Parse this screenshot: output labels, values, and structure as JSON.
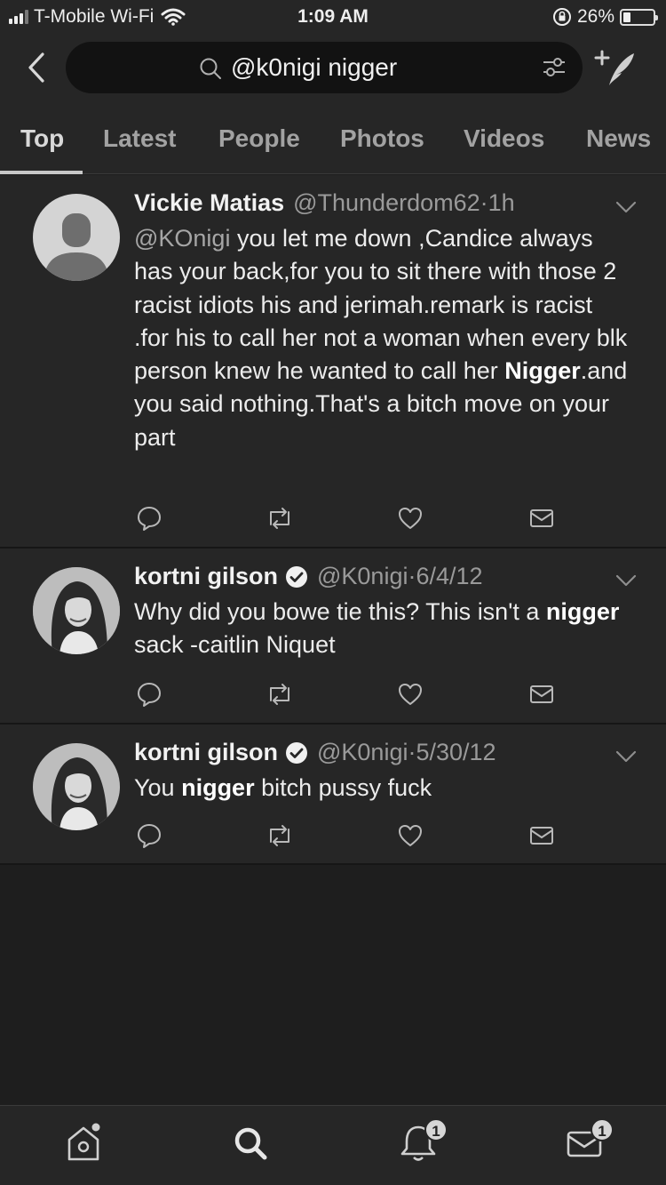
{
  "status_bar": {
    "carrier": "T-Mobile Wi-Fi",
    "time": "1:09 AM",
    "battery_percent": "26%",
    "battery_level": 0.26
  },
  "search": {
    "query": "@k0nigi nigger",
    "icons": [
      "back-chevron-icon",
      "search-icon",
      "filter-icon",
      "compose-tweet-icon"
    ]
  },
  "tabs": [
    "Top",
    "Latest",
    "People",
    "Photos",
    "Videos",
    "News"
  ],
  "active_tab": "Top",
  "tweets": [
    {
      "name": "Vickie Matias",
      "handle": "@Thunderdom62",
      "time": "1h",
      "verified": false,
      "body": {
        "mention": "@KOnigi",
        "text1": " you let me down ,Candice always has your back,for you to sit there with those 2 racist idiots his and jerimah.remark is racist .for his to call her not a woman when every blk person knew he wanted to call her ",
        "highlight": "Nigger",
        "text2": ".and you said nothing.That's a bitch move on your part"
      }
    },
    {
      "name": "kortni gilson",
      "handle": "@K0nigi",
      "time": "6/4/12",
      "verified": true,
      "body": {
        "text1": "Why did you bowe tie this? This isn't a ",
        "highlight": "nigger",
        "text2": " sack -caitlin Niquet"
      }
    },
    {
      "name": "kortni gilson",
      "handle": "@K0nigi",
      "time": "5/30/12",
      "verified": true,
      "body": {
        "text1": "You ",
        "highlight": "nigger",
        "text2": " bitch pussy fuck"
      }
    }
  ],
  "bottom_nav": {
    "items": [
      "home-icon",
      "explore-search-icon",
      "notifications-bell-icon",
      "messages-envelope-icon"
    ],
    "notifications_badge": "1",
    "messages_badge": "1"
  },
  "colors": {
    "background": "#1e1e1e",
    "surface": "#262626",
    "search_field": "#121212",
    "text": "#ececec",
    "secondary_text": "#9a9a9a"
  }
}
